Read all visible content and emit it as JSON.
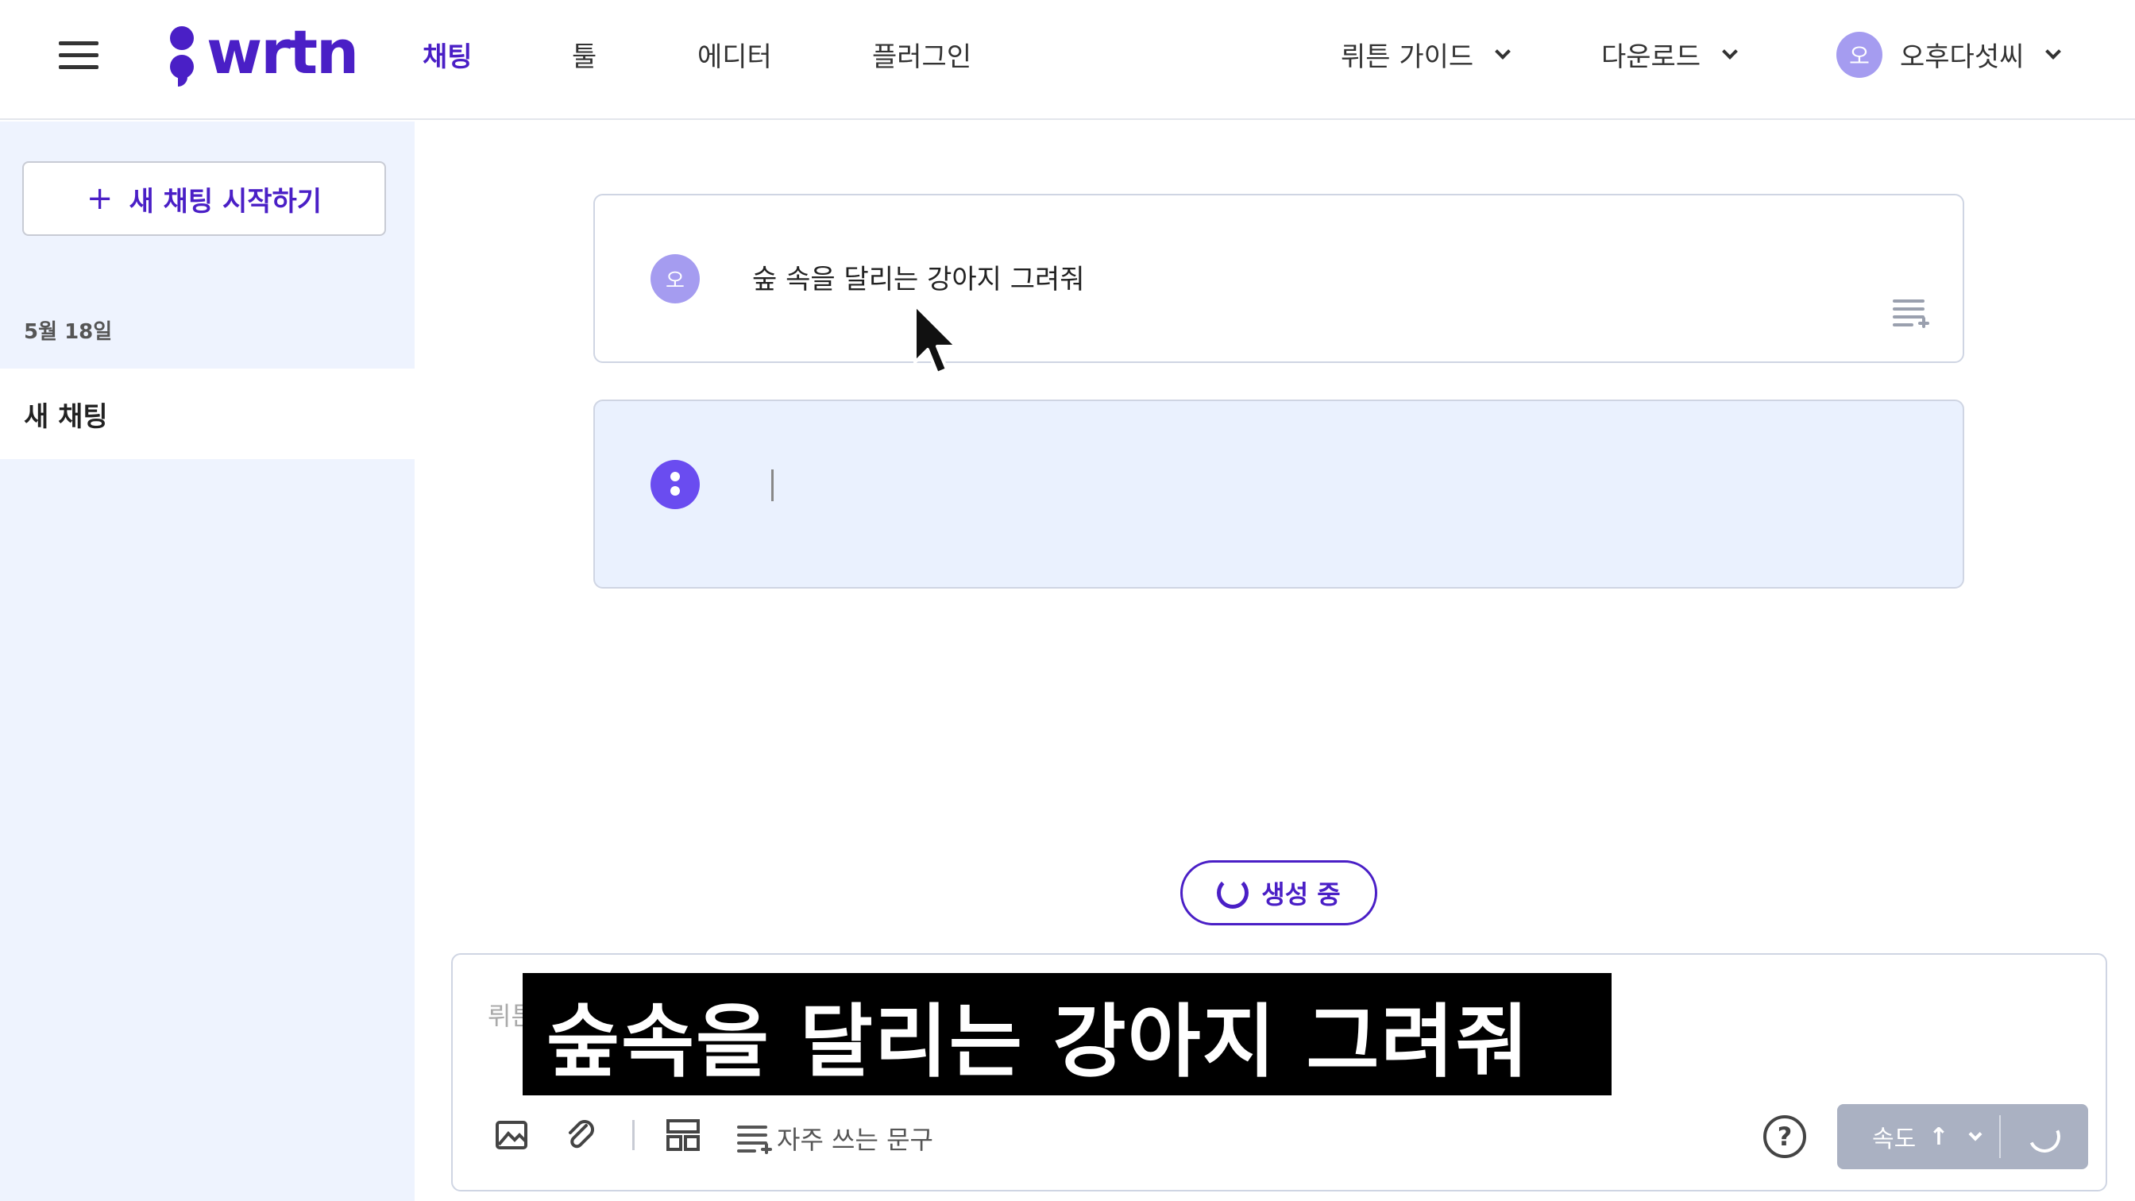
{
  "header": {
    "logo_text": "wrtn",
    "nav": [
      {
        "label": "채팅",
        "active": true
      },
      {
        "label": "툴"
      },
      {
        "label": "에디터"
      },
      {
        "label": "플러그인"
      }
    ],
    "guide_label": "뤼튼 가이드",
    "download_label": "다운로드",
    "user": {
      "avatar_initial": "오",
      "name": "오후다섯씨"
    }
  },
  "sidebar": {
    "new_chat_label": "새 채팅 시작하기",
    "date_group": "5월 18일",
    "chats": [
      {
        "title": "새 채팅"
      }
    ]
  },
  "conversation": {
    "user_message": {
      "avatar_initial": "오",
      "text": "숲 속을 달리는 강아지 그려줘"
    },
    "bot_message": {
      "text": ""
    }
  },
  "status": {
    "generating_label": "생성 중"
  },
  "composer": {
    "placeholder": "뤼튼에게",
    "caption_overlay": "숲속을 달리는 강아지 그려줘",
    "frequent_phrases_label": "자주 쓰는 문구",
    "help_label": "?",
    "speed_label": "속도",
    "speed_arrow": "↑"
  },
  "icons": [
    "menu-icon",
    "chevron-down-icon",
    "image-icon",
    "paperclip-icon",
    "layout-icon",
    "add-phrase-icon",
    "help-icon",
    "spinner-icon",
    "mouse-pointer-icon"
  ],
  "colors": {
    "brand": "#4a1fc6",
    "avatar": "#a59cf0",
    "bot_avatar": "#6a4cf0",
    "sidebar_bg": "#eef3fe",
    "bot_bubble": "#eaf1fe",
    "send_disabled": "#aab1c2"
  }
}
